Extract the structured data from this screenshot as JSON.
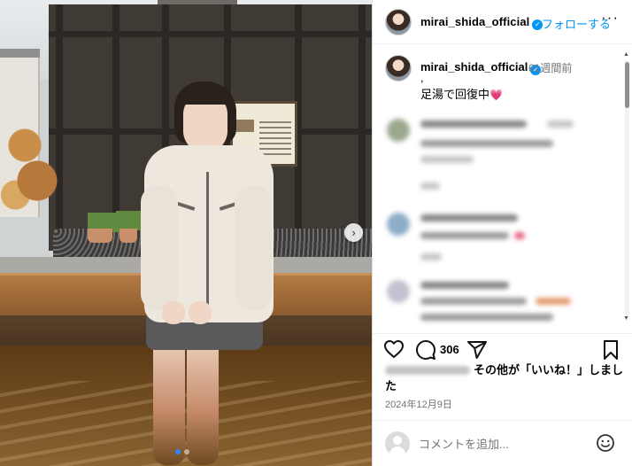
{
  "header": {
    "username": "mirai_shida_official",
    "follow_label": "フォローする",
    "more_label": "···"
  },
  "caption": {
    "username": "mirai_shida_official",
    "time_ago": "61週間前",
    "first_line": ",",
    "text": "足湯で回復中",
    "emoji": "💗"
  },
  "actions": {
    "comment_count": "306"
  },
  "likes": {
    "text": "その他が「いいね！」しました"
  },
  "post_date": "2024年12月9日",
  "comment_box": {
    "placeholder": "コメントを追加..."
  },
  "carousel": {
    "slide_count": 2,
    "active_slide": 1
  },
  "colors": {
    "accent": "#0095f6",
    "active_dot": "#2f86ff"
  },
  "icons": [
    "heart-icon",
    "comment-icon",
    "share-icon",
    "bookmark-icon",
    "smiley-icon",
    "chevron-right-icon",
    "verified-icon",
    "more-icon"
  ]
}
